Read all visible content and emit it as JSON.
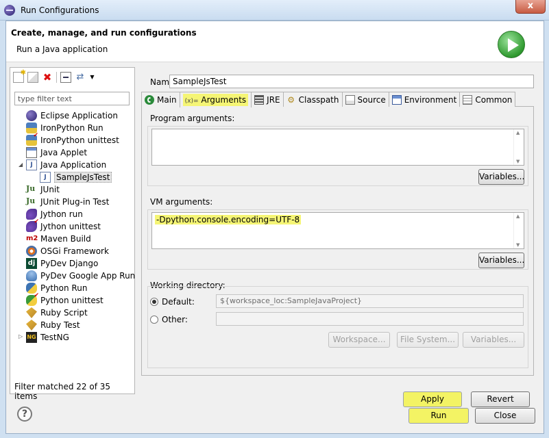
{
  "window": {
    "title": "Run Configurations",
    "close_glyph": "x"
  },
  "header": {
    "title": "Create, manage, and run configurations",
    "subtitle": "Run a Java application",
    "icon": "run-icon"
  },
  "left": {
    "filter_placeholder": "type filter text",
    "tree": [
      {
        "label": "Eclipse Application",
        "icon": "eclipse-icon"
      },
      {
        "label": "IronPython Run",
        "icon": "ironpython-icon"
      },
      {
        "label": "IronPython unittest",
        "icon": "ironpython-unittest-icon"
      },
      {
        "label": "Java Applet",
        "icon": "java-applet-icon"
      },
      {
        "label": "Java Application",
        "icon": "java-application-icon",
        "expanded": true
      },
      {
        "label": "SampleJsTest",
        "icon": "java-file-icon",
        "selected": true
      },
      {
        "label": "JUnit",
        "icon": "junit-icon",
        "icon_text": "Ju"
      },
      {
        "label": "JUnit Plug-in Test",
        "icon": "junit-plugin-icon",
        "icon_text": "Ju"
      },
      {
        "label": "Jython run",
        "icon": "jython-icon"
      },
      {
        "label": "Jython unittest",
        "icon": "jython-unittest-icon"
      },
      {
        "label": "Maven Build",
        "icon": "maven-icon",
        "icon_text": "m2"
      },
      {
        "label": "OSGi Framework",
        "icon": "osgi-icon"
      },
      {
        "label": "PyDev Django",
        "icon": "django-icon",
        "icon_text": "dj"
      },
      {
        "label": "PyDev Google App Run",
        "icon": "google-app-icon"
      },
      {
        "label": "Python Run",
        "icon": "python-icon"
      },
      {
        "label": "Python unittest",
        "icon": "python-unittest-icon"
      },
      {
        "label": "Ruby Script",
        "icon": "ruby-icon"
      },
      {
        "label": "Ruby Test",
        "icon": "ruby-test-icon"
      },
      {
        "label": "TestNG",
        "icon": "testng-icon",
        "icon_text": "NG",
        "collapsed": true
      }
    ],
    "status": "Filter matched 22 of 35 items"
  },
  "right": {
    "name_label": "Name:",
    "name_value": "SampleJsTest",
    "tabs": [
      {
        "label": "Main",
        "icon": "main-tab-icon"
      },
      {
        "label": "Arguments",
        "icon": "arguments-tab-icon",
        "icon_text": "(x)=",
        "active": true
      },
      {
        "label": "JRE",
        "icon": "jre-tab-icon"
      },
      {
        "label": "Classpath",
        "icon": "classpath-tab-icon"
      },
      {
        "label": "Source",
        "icon": "source-tab-icon"
      },
      {
        "label": "Environment",
        "icon": "environment-tab-icon"
      },
      {
        "label": "Common",
        "icon": "common-tab-icon"
      }
    ],
    "program_args": {
      "label": "Program arguments:",
      "value": "",
      "variables": "Variables..."
    },
    "vm_args": {
      "label": "VM arguments:",
      "value": "-Dpython.console.encoding=UTF-8",
      "variables": "Variables..."
    },
    "working_dir": {
      "label": "Working directory:",
      "default_label": "Default:",
      "default_value": "${workspace_loc:SampleJavaProject}",
      "other_label": "Other:",
      "other_value": "",
      "workspace": "Workspace...",
      "file_system": "File System...",
      "variables": "Variables..."
    },
    "apply": "Apply",
    "revert": "Revert"
  },
  "footer": {
    "help": "?",
    "run": "Run",
    "close": "Close"
  },
  "colors": {
    "highlight": "#f5f575",
    "title_bar": "#c9dcf0",
    "close_red": "#c75b42"
  }
}
